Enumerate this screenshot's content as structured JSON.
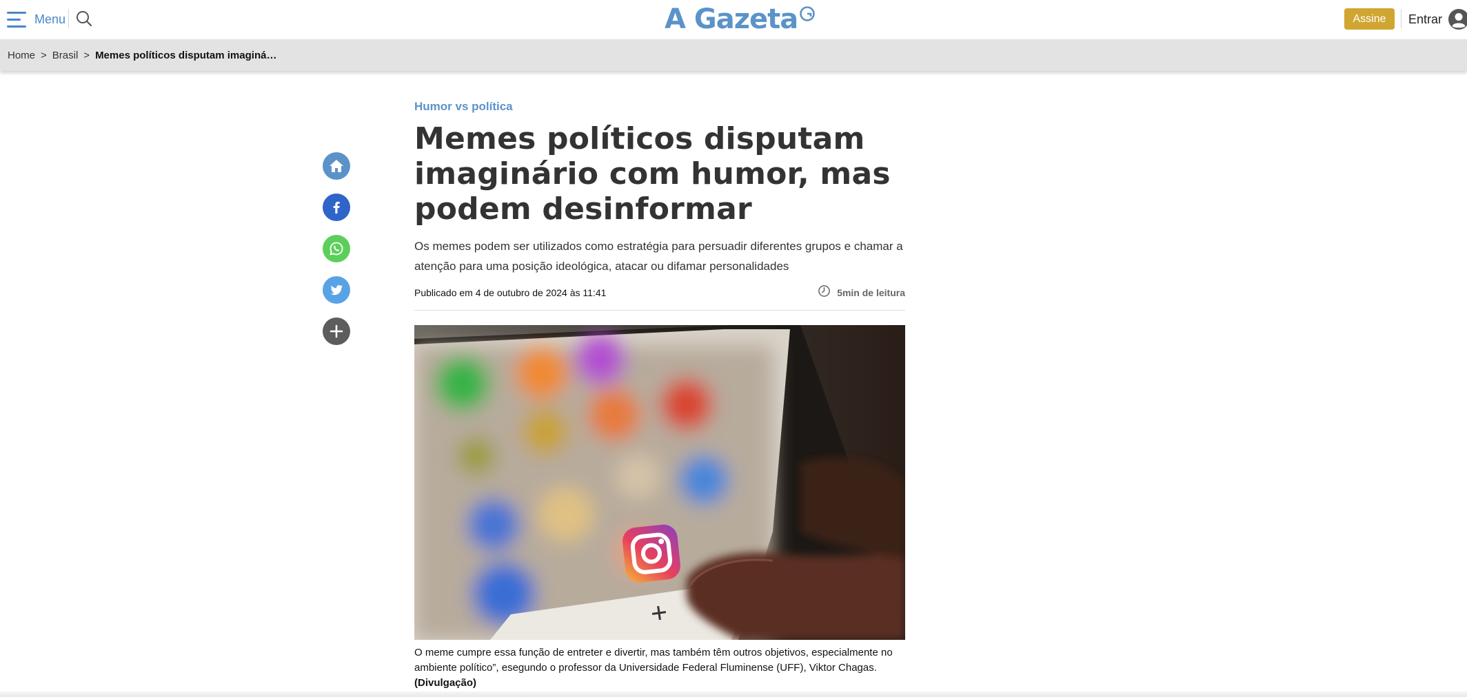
{
  "header": {
    "menu_label": "Menu",
    "logo_text": "A Gazeta",
    "subscribe_label": "Assine",
    "login_label": "Entrar"
  },
  "breadcrumb": {
    "items": [
      "Home",
      "Brasil"
    ],
    "separator": ">",
    "current": "Memes políticos disputam imaginá…"
  },
  "share_icons": [
    "home-icon",
    "facebook-icon",
    "whatsapp-icon",
    "twitter-icon",
    "plus-icon"
  ],
  "article": {
    "kicker": "Humor vs política",
    "title": "Memes políticos disputam imaginário com humor, mas podem desinformar",
    "lead": "Os memes podem ser utilizados como estratégia para persuadir diferentes grupos e chamar a atenção para uma posição ideológica, atacar ou difamar personalidades",
    "published": "Publicado em 4 de outubro de 2024 às 11:41",
    "read_time": "5min de leitura",
    "caption": "O meme cumpre essa função de entreter e divertir, mas também têm outros objetivos, especialmente no ambiente político”, esegundo o professor da Universidade Federal Fluminense (UFF), Viktor Chagas.",
    "caption_credit": "(Divulgação)"
  },
  "colors": {
    "brand_blue": "#5b93c9",
    "subscribe_gold": "#d1a532",
    "breadcrumb_bg": "#e3e3e3",
    "home_share": "#5b93c9",
    "facebook": "#2f64c8",
    "whatsapp": "#5ccf5b",
    "twitter": "#5aa2e6",
    "more": "#5d5d5d"
  }
}
